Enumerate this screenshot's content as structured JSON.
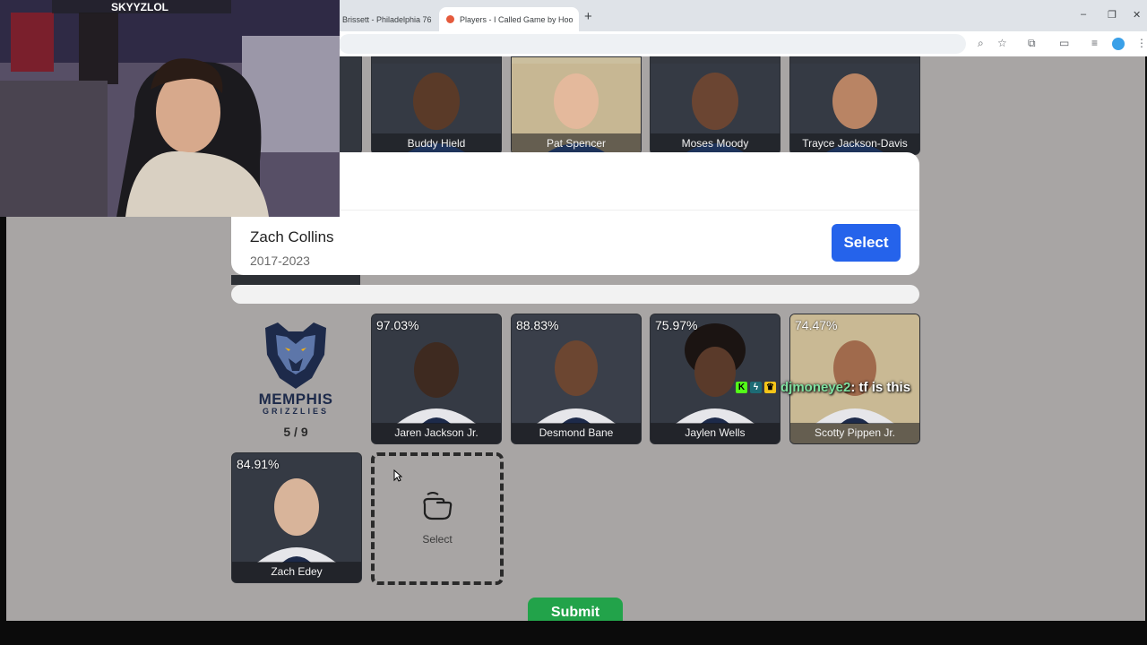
{
  "browser": {
    "tabs": [
      {
        "label": "Brissett - Philadelphia 76",
        "active": false
      },
      {
        "label": "Players - I Called Game by Hoo",
        "active": true
      }
    ],
    "new_tab_glyph": "+",
    "window_controls": [
      "–",
      "❐",
      "✕"
    ]
  },
  "top_row_players": [
    "Buddy Hield",
    "Pat Spencer",
    "Moses Moody",
    "Trayce Jackson-Davis"
  ],
  "modal": {
    "player_name": "Zach Collins",
    "years": "2017-2023",
    "select_label": "Select"
  },
  "team": {
    "name_line1": "MEMPHIS",
    "name_line2": "GRIZZLIES",
    "count": "5 / 9",
    "colors": {
      "navy": "#1d2a4a",
      "blue": "#5d76a9",
      "gold": "#f5b112"
    }
  },
  "selected_players": [
    {
      "name": "Jaren Jackson Jr.",
      "pct": "97.03%"
    },
    {
      "name": "Desmond Bane",
      "pct": "88.83%"
    },
    {
      "name": "Jaylen Wells",
      "pct": "75.97%"
    },
    {
      "name": "Scotty Pippen Jr.",
      "pct": "74.47%"
    },
    {
      "name": "Zach Edey",
      "pct": "84.91%"
    }
  ],
  "empty_slot": {
    "label": "Select",
    "icon": "tap-hand-icon"
  },
  "submit_label": "Submit",
  "chat": {
    "username": "djmoneye2",
    "message": ": tf is this",
    "badges": [
      "kick-icon",
      "bolt-icon",
      "crown-icon"
    ]
  },
  "streamer_overlay": {
    "handle": "SKYYZLOL"
  },
  "accent_colors": {
    "select_blue": "#2563eb",
    "submit_green": "#22a34a",
    "page_bg": "#a8a5a4"
  }
}
